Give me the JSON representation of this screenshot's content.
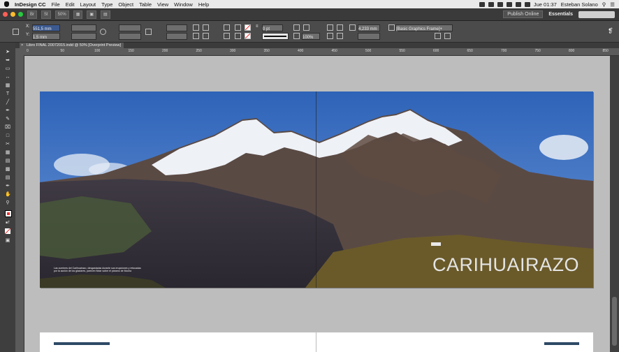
{
  "menubar": {
    "app": "InDesign CC",
    "items": [
      "File",
      "Edit",
      "Layout",
      "Type",
      "Object",
      "Table",
      "View",
      "Window",
      "Help"
    ],
    "clock": "Jue 01:37",
    "user": "Esteban Solano"
  },
  "appbar": {
    "zoom": "50%",
    "publish_label": "Publish Online",
    "workspace": "Essentials"
  },
  "control": {
    "x_value": "551,5 mm",
    "y_value": "1,5 mm",
    "stroke_weight": "0 pt",
    "opacity": "100%",
    "dimension": "4,233 mm",
    "object_style": "[Basic Graphics Frame]+"
  },
  "document": {
    "tab_title": "Libro FINAL 20072015.indd @ 50% [Overprint Preview]"
  },
  "ruler": {
    "ticks": [
      "0",
      "50",
      "100",
      "150",
      "200",
      "250",
      "300",
      "350",
      "400",
      "450",
      "500",
      "550",
      "600",
      "650",
      "700",
      "750",
      "800",
      "850"
    ]
  },
  "spread": {
    "title": "CARIHUAIRAZO",
    "caption": "Las cumbres del Carihuairazo, desgastadas durante sus erupciones y retocadas por la acción de los glaciares, parecen flotar sobre el páramo de Mocha"
  },
  "colors": {
    "sky": "#3a6fc0",
    "snow": "#f2f4f7",
    "rock": "#5a4a44",
    "grass": "#6a5a2a",
    "accent_bar": "#2e4a66"
  }
}
